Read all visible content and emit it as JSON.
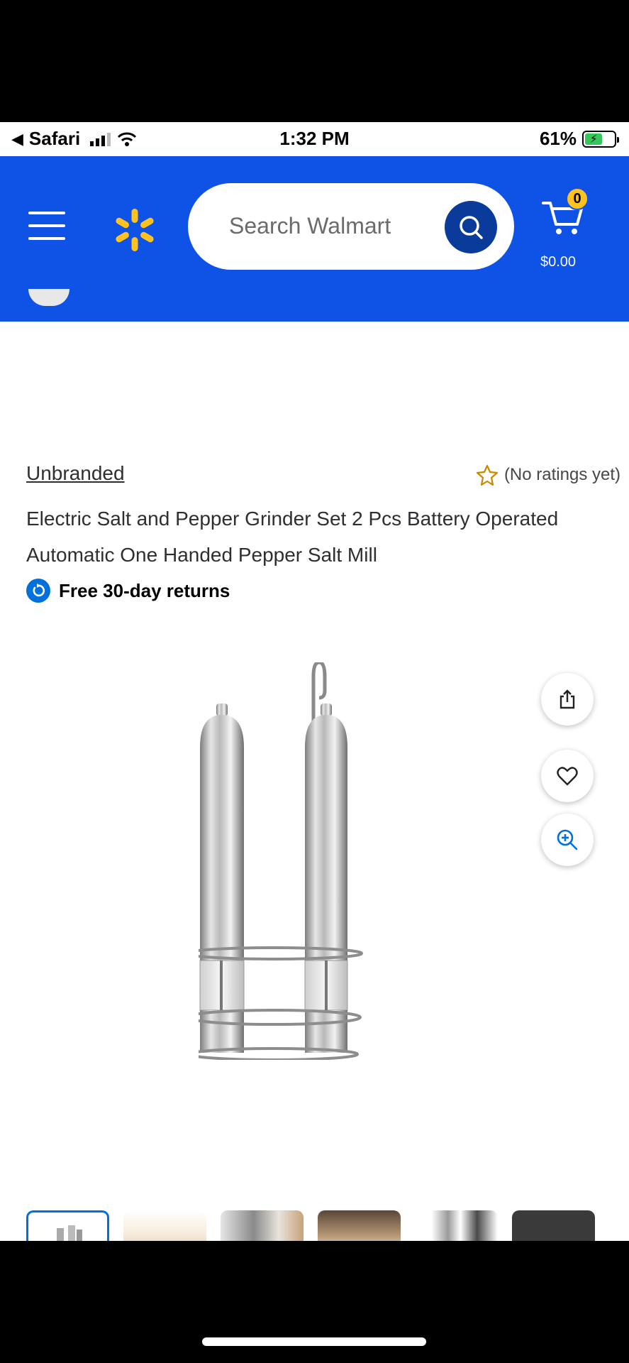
{
  "status_bar": {
    "back_app": "Safari",
    "time": "1:32 PM",
    "battery": "61%",
    "battery_level": 0.61
  },
  "header": {
    "search_placeholder": "Search Walmart",
    "cart_count": "0",
    "cart_total": "$0.00",
    "colors": {
      "background": "#0f52e6",
      "spark": "#ffc220",
      "search_button": "#0a3a9a"
    }
  },
  "product": {
    "brand": "Unbranded",
    "rating_text": "(No ratings yet)",
    "title": "Electric Salt and Pepper Grinder Set 2 Pcs Battery Operated Automatic One Handed Pepper Salt Mill",
    "returns": "Free 30-day returns"
  },
  "icons": {
    "menu": "menu-icon",
    "logo": "walmart-spark-icon",
    "search": "search-icon",
    "cart": "cart-icon",
    "star": "star-outline-icon",
    "returns": "returns-icon",
    "share": "share-icon",
    "favorite": "heart-icon",
    "zoom": "zoom-in-icon"
  }
}
